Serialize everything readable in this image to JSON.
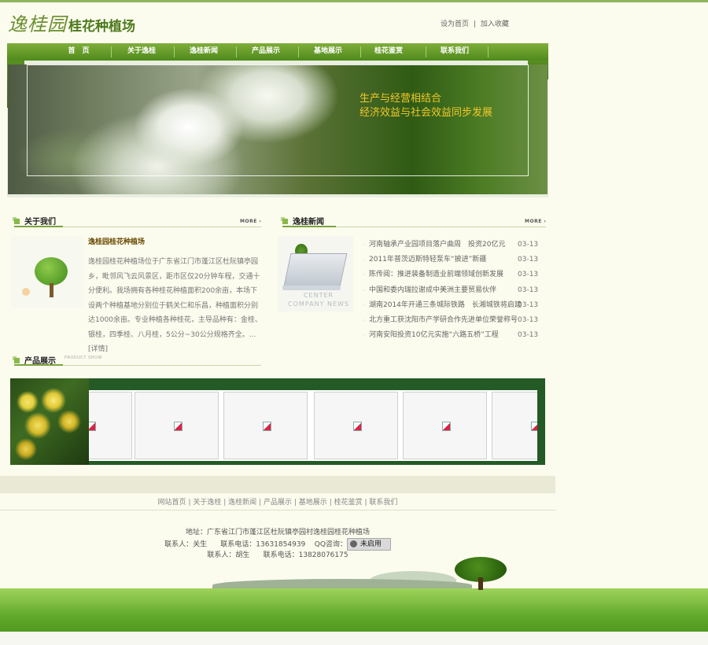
{
  "header": {
    "logo_calligraphy": "逸桂园",
    "logo_text": "桂花种植场",
    "set_home": "设为首页",
    "separator": "|",
    "add_favorite": "加入收藏"
  },
  "nav": {
    "items": [
      "首　页",
      "关于逸桂",
      "逸桂新闻",
      "产品展示",
      "基地展示",
      "桂花鉴赏",
      "联系我们"
    ]
  },
  "banner": {
    "slogan_line1": "生产与经营相结合",
    "slogan_line2": "经济效益与社会效益同步发展"
  },
  "about": {
    "title": "关于我们",
    "more": "MORE",
    "company_name": "逸桂园桂花种植场",
    "description": "逸桂园桂花种植场位于广东省江门市蓬江区杜阮镇亭园乡，毗邻风飞云风景区，距市区仅20分钟车程，交通十分便利。我场拥有各种桂花种植面积200余亩，本场下设两个种植基地分别位于鹤关仁和乐昌，种植面积分别达1000余亩。专业种植各种桂花，主导品种有：金桂、银桂，四季桂、八月桂，5公分~30公分规格齐全。...",
    "detail_link": "[详情]"
  },
  "news": {
    "title": "逸桂新闻",
    "more": "MORE",
    "image_caption_line1": "CENTER",
    "image_caption_line2": "COMPANY NEWS",
    "items": [
      {
        "title": "河南轴承产业园项目落户曲周　投资20亿元",
        "date": "03-13"
      },
      {
        "title": "2011年普茨迈斯特轻泵车“披进”新疆",
        "date": "03-13"
      },
      {
        "title": "陈传阅：推进装备制造业前端领域创新发展",
        "date": "03-13"
      },
      {
        "title": "中国和委内瑞拉谢成中美洲主要贸易伙伴",
        "date": "03-13"
      },
      {
        "title": "湖南2014年开通三条城际铁路　长湘城铁将启建",
        "date": "03-13"
      },
      {
        "title": "北方重工获沈阳市产学研合作先进单位荣誉称号",
        "date": "03-13"
      },
      {
        "title": "河南安阳投资10亿元实施“六路五桥”工程",
        "date": "03-13"
      }
    ]
  },
  "products": {
    "title": "产品展示",
    "subtitle": "PRODUCT SHOW",
    "count": 6
  },
  "footer": {
    "links": [
      "网站首页",
      "关于逸桂",
      "逸桂新闻",
      "产品展示",
      "基地展示",
      "桂花鉴赏",
      "联系我们"
    ],
    "link_separator": "|",
    "address": "地址：广东省江门市蓬江区杜阮镇亭园村逸桂园桂花种植场",
    "contact1_label": "联系人：关生",
    "contact1_phone": "联系电话：13631854939",
    "qq_label": "QQ咨询：",
    "qq_status": "未启用",
    "contact2_label": "联系人：胡生",
    "contact2_phone": "联系电话：13828076175"
  },
  "colors": {
    "nav_green": "#5a921f",
    "slogan_yellow": "#f2c72a",
    "product_panel": "#245a26"
  }
}
